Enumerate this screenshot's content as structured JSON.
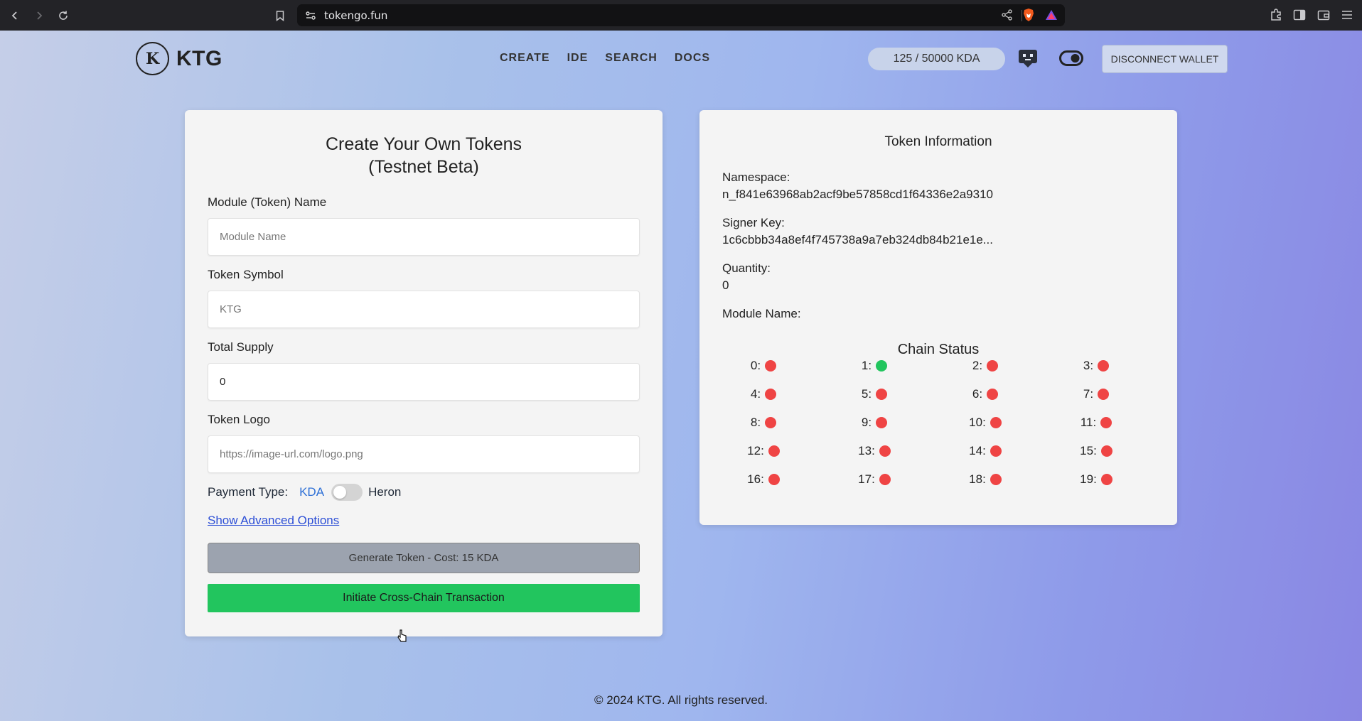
{
  "browser": {
    "url": "tokengo.fun"
  },
  "header": {
    "logo_letter": "K",
    "logo_text": "KTG",
    "nav": [
      "CREATE",
      "IDE",
      "SEARCH",
      "DOCS"
    ],
    "balance": "125 / 50000 KDA",
    "disconnect_label": "DISCONNECT WALLET"
  },
  "form": {
    "title_line1": "Create Your Own Tokens",
    "title_line2": "(Testnet Beta)",
    "module_label": "Module (Token) Name",
    "module_placeholder": "Module Name",
    "symbol_label": "Token Symbol",
    "symbol_placeholder": "KTG",
    "supply_label": "Total Supply",
    "supply_value": "0",
    "logo_label": "Token Logo",
    "logo_placeholder": "https://image-url.com/logo.png",
    "payment_label": "Payment Type:",
    "payment_kda": "KDA",
    "payment_heron": "Heron",
    "advanced_link": "Show Advanced Options",
    "generate_label": "Generate Token - Cost: 15 KDA",
    "cross_chain_label": "Initiate Cross-Chain Transaction"
  },
  "info": {
    "title": "Token Information",
    "namespace_label": "Namespace:",
    "namespace_value": "n_f841e63968ab2acf9be57858cd1f64336e2a9310",
    "signer_label": "Signer Key:",
    "signer_value": "1c6cbbb34a8ef4f745738a9a7eb324db84b21e1e...",
    "quantity_label": "Quantity:",
    "quantity_value": "0",
    "module_name_label": "Module Name:",
    "chain_status_title": "Chain Status",
    "chains": [
      {
        "label": "0:",
        "status": "red"
      },
      {
        "label": "1:",
        "status": "green"
      },
      {
        "label": "2:",
        "status": "red"
      },
      {
        "label": "3:",
        "status": "red"
      },
      {
        "label": "4:",
        "status": "red"
      },
      {
        "label": "5:",
        "status": "red"
      },
      {
        "label": "6:",
        "status": "red"
      },
      {
        "label": "7:",
        "status": "red"
      },
      {
        "label": "8:",
        "status": "red"
      },
      {
        "label": "9:",
        "status": "red"
      },
      {
        "label": "10:",
        "status": "red"
      },
      {
        "label": "11:",
        "status": "red"
      },
      {
        "label": "12:",
        "status": "red"
      },
      {
        "label": "13:",
        "status": "red"
      },
      {
        "label": "14:",
        "status": "red"
      },
      {
        "label": "15:",
        "status": "red"
      },
      {
        "label": "16:",
        "status": "red"
      },
      {
        "label": "17:",
        "status": "red"
      },
      {
        "label": "18:",
        "status": "red"
      },
      {
        "label": "19:",
        "status": "red"
      }
    ]
  },
  "colors": {
    "status_red": "#ef4444",
    "status_green": "#22c55e",
    "cross_chain_button": "#22c55e",
    "generate_button": "#9ca3af"
  },
  "footer": {
    "text": "© 2024 KTG. All rights reserved."
  }
}
